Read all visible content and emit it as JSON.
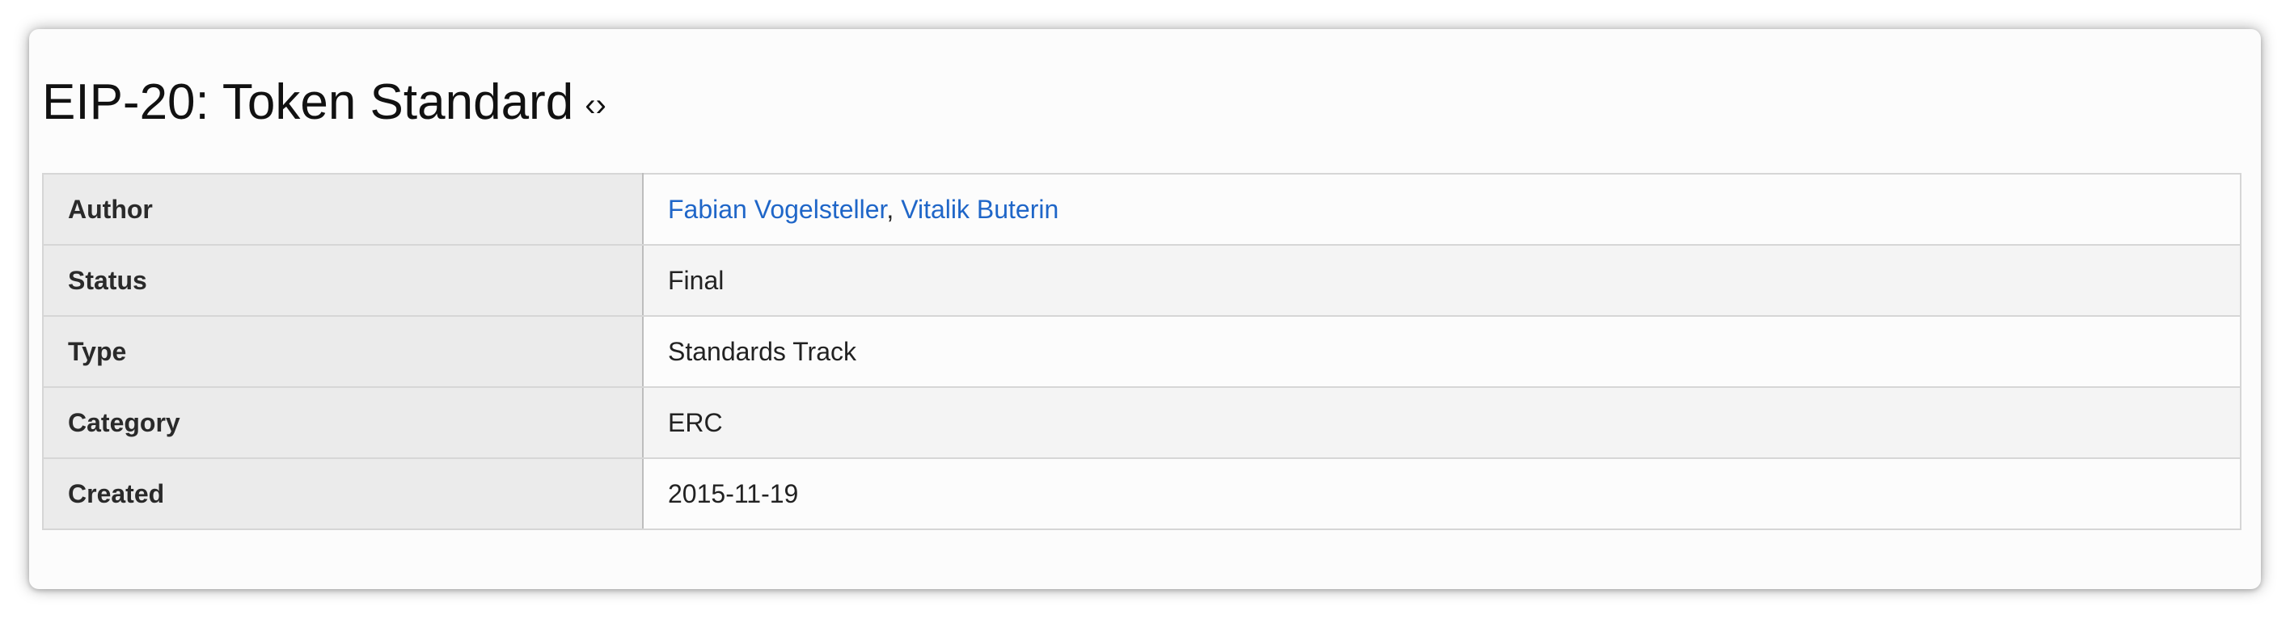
{
  "page": {
    "title": "EIP-20: Token Standard",
    "anchor_glyph": "‹›"
  },
  "preamble": {
    "rows": [
      {
        "label": "Author",
        "authors": [
          "Fabian Vogelsteller",
          "Vitalik Buterin"
        ],
        "separator": ","
      },
      {
        "label": "Status",
        "value": "Final"
      },
      {
        "label": "Type",
        "value": "Standards Track"
      },
      {
        "label": "Category",
        "value": "ERC"
      },
      {
        "label": "Created",
        "value": "2015-11-19"
      }
    ]
  },
  "colors": {
    "link": "#1f66c8",
    "header_cell_bg": "#ebebeb",
    "stripe_bg": "#f4f4f4"
  }
}
